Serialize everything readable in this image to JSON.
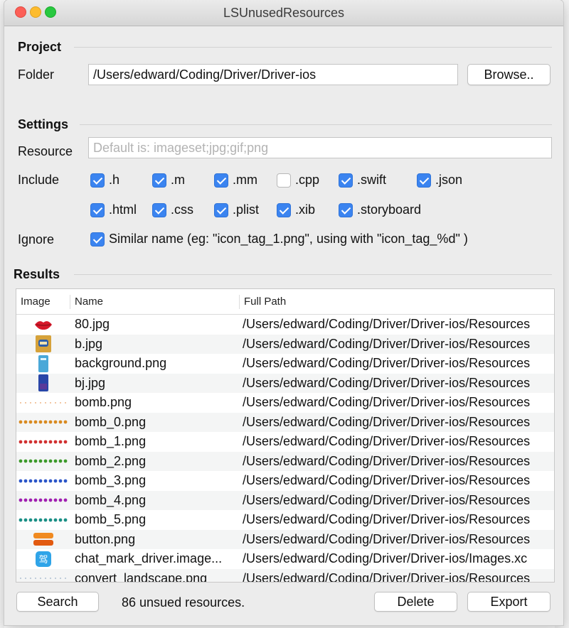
{
  "window": {
    "title": "LSUnusedResources"
  },
  "project": {
    "section_title": "Project",
    "folder_label": "Folder",
    "folder_value": "/Users/edward/Coding/Driver/Driver-ios",
    "browse_label": "Browse.."
  },
  "settings": {
    "section_title": "Settings",
    "resource_label": "Resource",
    "resource_placeholder": "Default is: imageset;jpg;gif;png",
    "include_label": "Include",
    "include_options": [
      {
        "label": ".h",
        "checked": true
      },
      {
        "label": ".m",
        "checked": true
      },
      {
        "label": ".mm",
        "checked": true
      },
      {
        "label": ".cpp",
        "checked": false
      },
      {
        "label": ".swift",
        "checked": true
      },
      {
        "label": ".json",
        "checked": true
      },
      {
        "label": ".html",
        "checked": true
      },
      {
        "label": ".css",
        "checked": true
      },
      {
        "label": ".plist",
        "checked": true
      },
      {
        "label": ".xib",
        "checked": true
      },
      {
        "label": ".storyboard",
        "checked": true
      }
    ],
    "ignore_label": "Ignore",
    "ignore_option": {
      "label": "Similar name (eg: \"icon_tag_1.png\", using with \"icon_tag_%d\" )",
      "checked": true
    }
  },
  "results": {
    "section_title": "Results",
    "columns": [
      "Image",
      "Name",
      "Full Path"
    ],
    "rows": [
      {
        "thumb": "lips-icon",
        "name": "80.jpg",
        "path": "/Users/edward/Coding/Driver/Driver-ios/Resources"
      },
      {
        "thumb": "badge-icon",
        "name": "b.jpg",
        "path": "/Users/edward/Coding/Driver/Driver-ios/Resources"
      },
      {
        "thumb": "phone-blue-icon",
        "name": "background.png",
        "path": "/Users/edward/Coding/Driver/Driver-ios/Resources"
      },
      {
        "thumb": "phone-dark-icon",
        "name": "bj.jpg",
        "path": "/Users/edward/Coding/Driver/Driver-ios/Resources"
      },
      {
        "thumb": "dots-orange",
        "name": "bomb.png",
        "path": "/Users/edward/Coding/Driver/Driver-ios/Resources"
      },
      {
        "thumb": "dots-amber",
        "name": "bomb_0.png",
        "path": "/Users/edward/Coding/Driver/Driver-ios/Resources"
      },
      {
        "thumb": "dots-red",
        "name": "bomb_1.png",
        "path": "/Users/edward/Coding/Driver/Driver-ios/Resources"
      },
      {
        "thumb": "dots-green",
        "name": "bomb_2.png",
        "path": "/Users/edward/Coding/Driver/Driver-ios/Resources"
      },
      {
        "thumb": "dots-blue",
        "name": "bomb_3.png",
        "path": "/Users/edward/Coding/Driver/Driver-ios/Resources"
      },
      {
        "thumb": "dots-purple",
        "name": "bomb_4.png",
        "path": "/Users/edward/Coding/Driver/Driver-ios/Resources"
      },
      {
        "thumb": "dots-teal",
        "name": "bomb_5.png",
        "path": "/Users/edward/Coding/Driver/Driver-ios/Resources"
      },
      {
        "thumb": "button-orange-icon",
        "name": "button.png",
        "path": "/Users/edward/Coding/Driver/Driver-ios/Resources"
      },
      {
        "thumb": "chat-mark-icon",
        "name": "chat_mark_driver.image...",
        "path": "/Users/edward/Coding/Driver/Driver-ios/Images.xc"
      },
      {
        "thumb": "dots-gray",
        "name": "convert_landscape.png",
        "path": "/Users/edward/Coding/Driver/Driver-ios/Resources"
      }
    ]
  },
  "footer": {
    "search_label": "Search",
    "status_text": "86 unsued resources.",
    "delete_label": "Delete",
    "export_label": "Export"
  },
  "colors": {
    "checkbox": "#3b84f0",
    "window_bg": "#ececec"
  }
}
